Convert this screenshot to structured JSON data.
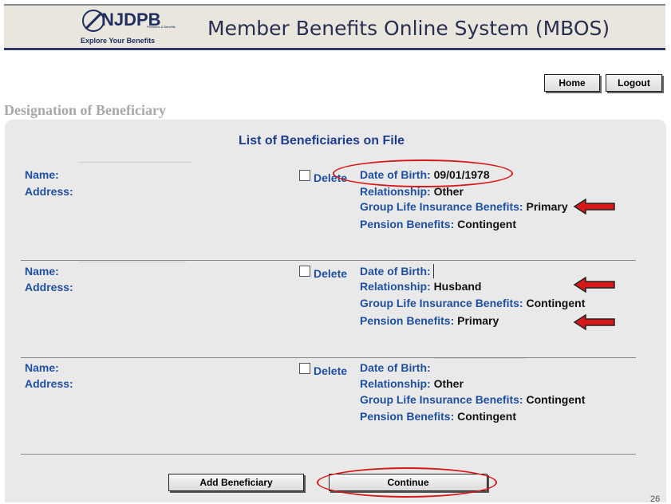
{
  "header": {
    "logo_text": "NJDPB",
    "logo_small": "Pensions & Benefits",
    "logo_tagline": "Explore Your Benefits",
    "app_title": "Member Benefits Online System (MBOS)"
  },
  "nav": {
    "home": "Home",
    "logout": "Logout"
  },
  "page_title": "Designation of Beneficiary",
  "list_title": "List of Beneficiaries on File",
  "labels": {
    "name": "Name:",
    "address": "Address:",
    "delete": "Delete",
    "dob": "Date of Birth:",
    "relationship": "Relationship:",
    "life": "Group Life Insurance Benefits:",
    "pension": "Pension Benefits:"
  },
  "beneficiaries": [
    {
      "dob": "09/01/1978",
      "relationship": "Other",
      "life": "Primary",
      "pension": "Contingent"
    },
    {
      "dob": "",
      "relationship": "Husband",
      "life": "Contingent",
      "pension": "Primary"
    },
    {
      "dob": "",
      "relationship": "Other",
      "life": "Contingent",
      "pension": "Contingent"
    }
  ],
  "buttons": {
    "add": "Add Beneficiary",
    "continue": "Continue"
  },
  "page_number": "26",
  "colors": {
    "label_blue": "#1f50a0",
    "annotation_red": "#d81818",
    "header_navy": "#2f3a6b"
  }
}
